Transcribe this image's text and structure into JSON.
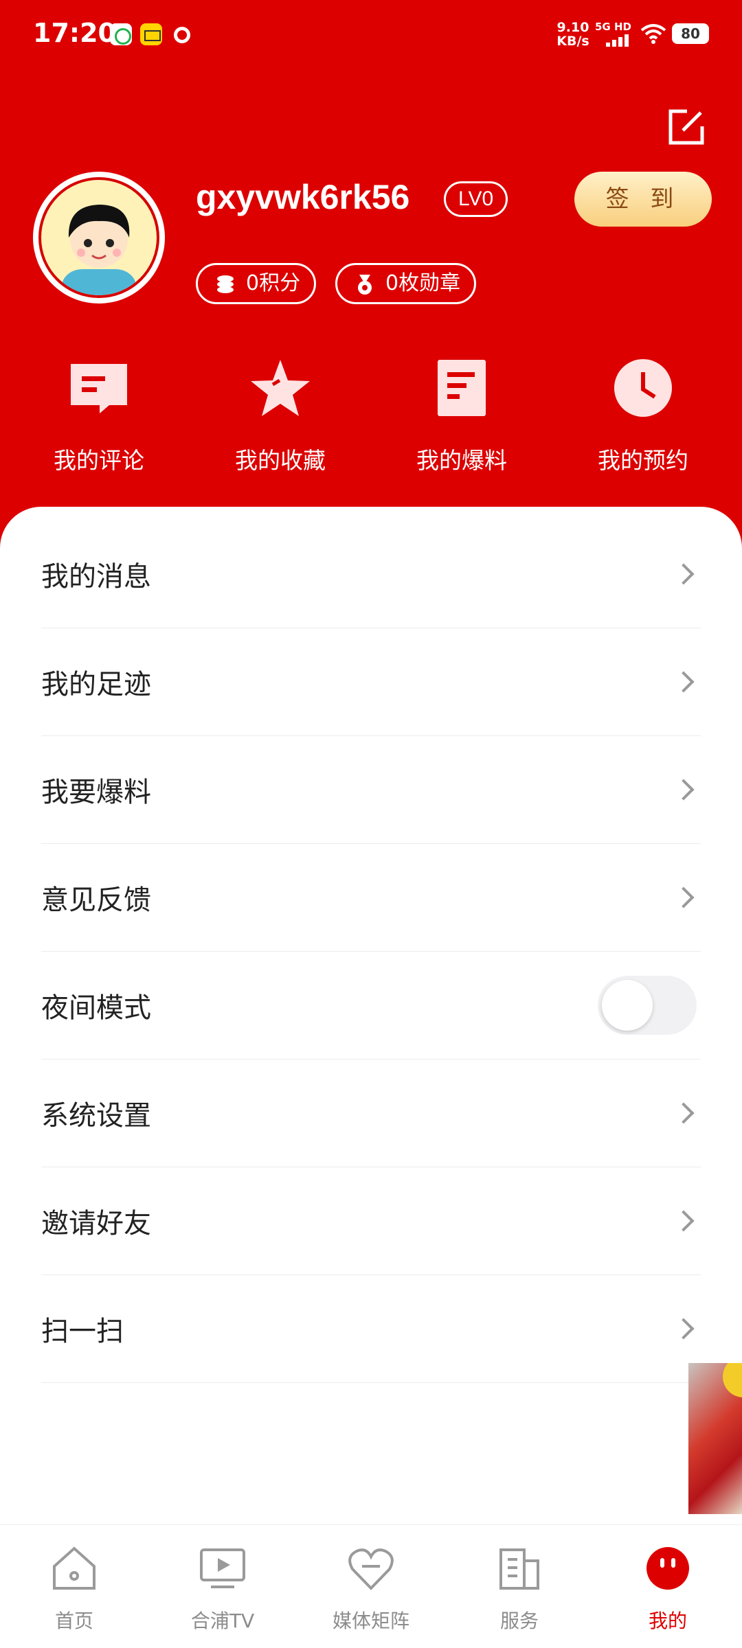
{
  "status_bar": {
    "time": "17:20",
    "net_speed_value": "9.10",
    "net_speed_unit": "KB/s",
    "network": "5G HD",
    "battery": "80"
  },
  "profile": {
    "username": "gxyvwk6rk56",
    "level": "LV0",
    "checkin_label": "签 到",
    "points_label": "0积分",
    "medals_label": "0枚勋章"
  },
  "quick_actions": [
    {
      "label": "我的评论",
      "icon": "comment-icon"
    },
    {
      "label": "我的收藏",
      "icon": "star-icon"
    },
    {
      "label": "我的爆料",
      "icon": "report-doc-icon"
    },
    {
      "label": "我的预约",
      "icon": "clock-icon"
    }
  ],
  "menu": [
    {
      "label": "我的消息"
    },
    {
      "label": "我的足迹"
    },
    {
      "label": "我要爆料"
    },
    {
      "label": "意见反馈"
    },
    {
      "label": "夜间模式",
      "toggle": false
    },
    {
      "label": "系统设置"
    },
    {
      "label": "邀请好友"
    },
    {
      "label": "扫一扫"
    }
  ],
  "tabs": [
    {
      "label": "首页",
      "icon": "home-icon"
    },
    {
      "label": "合浦TV",
      "icon": "tv-play-icon"
    },
    {
      "label": "媒体矩阵",
      "icon": "heart-link-icon"
    },
    {
      "label": "服务",
      "icon": "building-icon"
    },
    {
      "label": "我的",
      "icon": "profile-face-icon",
      "active": true
    }
  ],
  "colors": {
    "brand_red": "#dd0000",
    "checkin_gold": "#f9cf7e",
    "inactive_gray": "#8c8c8c"
  }
}
